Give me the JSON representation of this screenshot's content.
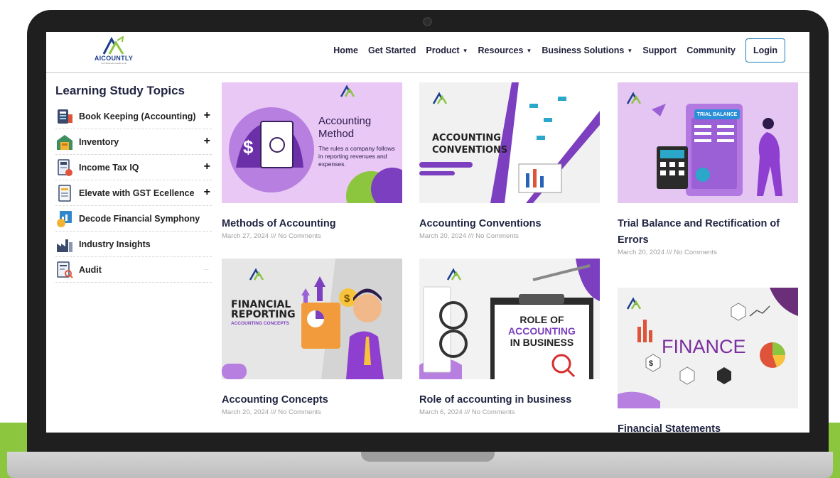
{
  "brand": {
    "name": "AICOUNTLY",
    "tagline": "Your Business Leads on an"
  },
  "nav": {
    "items": [
      {
        "label": "Home",
        "caret": false
      },
      {
        "label": "Get Started",
        "caret": false
      },
      {
        "label": "Product",
        "caret": true
      },
      {
        "label": "Resources",
        "caret": true
      },
      {
        "label": "Business Solutions",
        "caret": true
      },
      {
        "label": "Support",
        "caret": false
      },
      {
        "label": "Community",
        "caret": false
      }
    ],
    "login": "Login"
  },
  "sidebar": {
    "title": "Learning Study Topics",
    "items": [
      {
        "label": "Book Keeping (Accounting)",
        "icon": "ledger-book-icon",
        "expand": "+"
      },
      {
        "label": "Inventory",
        "icon": "warehouse-icon",
        "expand": "+"
      },
      {
        "label": "Income Tax IQ",
        "icon": "tax-document-icon",
        "expand": "+"
      },
      {
        "label": "Elevate with GST Ecellence",
        "icon": "gst-document-icon",
        "expand": "+"
      },
      {
        "label": "Decode Financial Symphony",
        "icon": "financial-report-icon",
        "expand": ""
      },
      {
        "label": "Industry Insights",
        "icon": "factory-icon",
        "expand": ""
      },
      {
        "label": "Audit",
        "icon": "audit-icon",
        "expand": "..."
      }
    ]
  },
  "posts": [
    {
      "title": "Methods of Accounting",
      "meta": "March 27, 2024 /// No Comments",
      "thumb": {
        "heading": "Accounting Method",
        "body": "The rules a company follows in reporting revenues and expenses."
      }
    },
    {
      "title": "Accounting Conventions",
      "meta": "March 20, 2024 /// No Comments",
      "thumb": {
        "heading": "ACCOUNTING CONVENTIONS"
      }
    },
    {
      "title": "Trial Balance and Rectification of Errors",
      "meta": "March 20, 2024 /// No Comments",
      "thumb": {
        "heading": "TRIAL BALANCE"
      }
    },
    {
      "title": "Accounting Concepts",
      "meta": "March 20, 2024 /// No Comments",
      "thumb": {
        "heading": "FINANCIAL REPORTING",
        "sub": "ACCOUNTING CONCEPTS"
      }
    },
    {
      "title": "Role of accounting in business",
      "meta": "March 6, 2024 /// No Comments",
      "thumb": {
        "line1": "ROLE OF",
        "line2": "ACCOUNTING",
        "line3": "IN BUSINESS"
      }
    },
    {
      "title": "Financial Statements",
      "meta": "",
      "thumb": {
        "heading": "FINANCE"
      }
    }
  ],
  "colors": {
    "accent_purple": "#7b3fbf",
    "brand_green": "#8cc63f",
    "brand_navy": "#1b3f8f",
    "login_border": "#1d7fb8"
  }
}
